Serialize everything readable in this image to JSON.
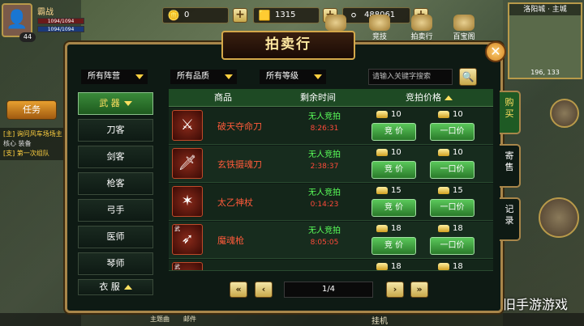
{
  "hud": {
    "player_name": "霸战",
    "level": "44",
    "hp_text": "1094/1094",
    "mp_text": "1094/1094",
    "resources": [
      {
        "icon": "gold-ingot-icon",
        "value": "0"
      },
      {
        "icon": "gold-bar-icon",
        "value": "1315"
      },
      {
        "icon": "silver-icon",
        "value": "488061"
      }
    ],
    "top_icons": [
      "商城",
      "竞技",
      "拍卖行",
      "百宝阁"
    ],
    "minimap_title": "洛阳城 · 主城",
    "minimap_coords": "196, 133",
    "task_tab": "任务",
    "quest_lines": [
      "[主] 询问风车场场主",
      "核心 装备",
      "[支] 第一次组队"
    ],
    "bottom_labels": [
      "主题曲",
      "邮件",
      "挂机"
    ],
    "watermark": "公众号 · 怀旧手游游戏"
  },
  "auction": {
    "title": "拍卖行",
    "filters": [
      "所有阵营",
      "所有品质",
      "所有等级"
    ],
    "search_placeholder": "请输入关键字搜索",
    "categories": [
      {
        "label": "武 器",
        "selected": true
      },
      {
        "label": "刀客"
      },
      {
        "label": "剑客"
      },
      {
        "label": "枪客"
      },
      {
        "label": "弓手"
      },
      {
        "label": "医师"
      },
      {
        "label": "琴师"
      },
      {
        "label": "衣 服"
      }
    ],
    "headers": {
      "item": "商品",
      "time": "剩余时间",
      "price": "竞拍价格"
    },
    "rows": [
      {
        "name": "破天夺命刀",
        "status": "无人竞拍",
        "time": "8:26:31",
        "bid": "10",
        "buyout": "10",
        "icon": "blade-icon",
        "tag": ""
      },
      {
        "name": "玄铁摄魂刀",
        "status": "无人竞拍",
        "time": "2:38:37",
        "bid": "10",
        "buyout": "10",
        "icon": "sword-icon",
        "tag": ""
      },
      {
        "name": "太乙神杖",
        "status": "无人竞拍",
        "time": "0:14:23",
        "bid": "15",
        "buyout": "15",
        "icon": "staff-icon",
        "tag": ""
      },
      {
        "name": "魔魂枪",
        "status": "无人竞拍",
        "time": "8:05:05",
        "bid": "18",
        "buyout": "18",
        "icon": "spear-icon",
        "tag": "武"
      },
      {
        "name": "",
        "status": "",
        "time": "",
        "bid": "18",
        "buyout": "18",
        "icon": "weapon-icon",
        "tag": "武"
      }
    ],
    "bid_label": "竞 价",
    "buyout_label": "一口价",
    "side_tabs": [
      {
        "label": "购\n买",
        "selected": true
      },
      {
        "label": "寄\n售"
      },
      {
        "label": "记\n录"
      }
    ],
    "pagination": "1/4"
  }
}
